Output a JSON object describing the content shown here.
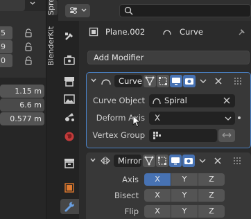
{
  "left_panel": {
    "row_numbers": [
      "5",
      "9",
      "0"
    ],
    "dimension_values": [
      "1.15 m",
      "6.6 m",
      "0.577 m"
    ]
  },
  "sidebar_tabs": {
    "top_tab": "Sprea",
    "blenderkit_tab": "BlenderKit"
  },
  "header": {
    "search_placeholder": ""
  },
  "context": {
    "object_name": "Plane.002",
    "modifier_name": "Curve"
  },
  "add_modifier_label": "Add Modifier",
  "curve_modifier": {
    "name": "Curve",
    "curve_object_label": "Curve Object",
    "curve_object_value": "Spiral",
    "deform_axis_label": "Deform Axis",
    "deform_axis_value": "X",
    "vertex_group_label": "Vertex Group",
    "vertex_group_value": ""
  },
  "mirror_modifier": {
    "name": "Mirror",
    "rows": [
      {
        "label": "Axis",
        "x": "X",
        "y": "Y",
        "z": "Z",
        "x_on": true
      },
      {
        "label": "Bisect",
        "x": "X",
        "y": "Y",
        "z": "Z",
        "x_on": false
      },
      {
        "label": "Flip",
        "x": "X",
        "y": "Y",
        "z": "Z",
        "x_on": false
      }
    ]
  },
  "colors": {
    "accent": "#4772b3",
    "panel_outline": "#4a82c7",
    "panel_bg": "#383838",
    "background": "#2b2b2b"
  }
}
